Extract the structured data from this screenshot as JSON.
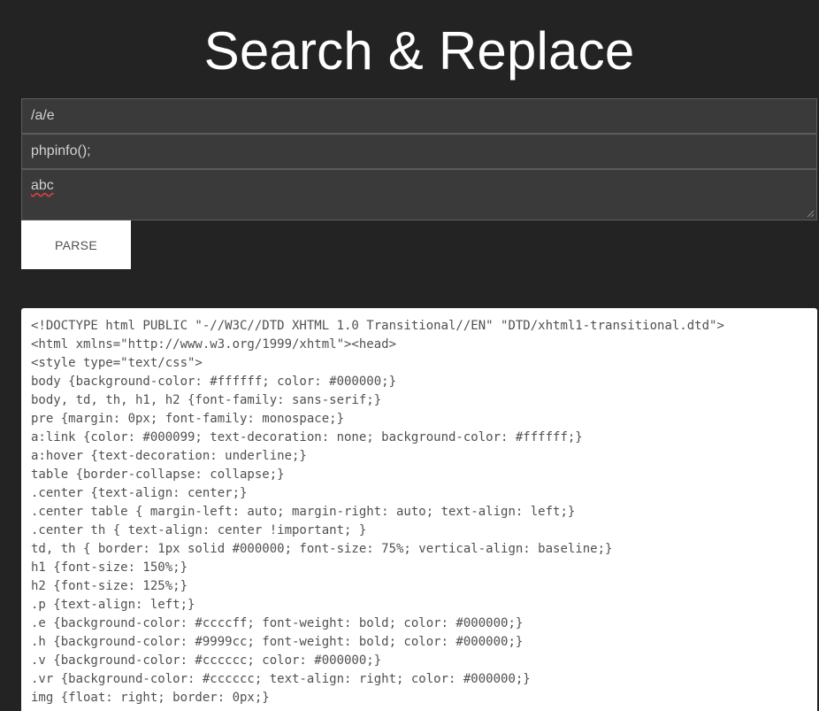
{
  "page": {
    "title": "Search & Replace"
  },
  "form": {
    "search_value": "/a/e",
    "replace_value": "phpinfo();",
    "subject_value": "abc",
    "parse_label": "PARSE"
  },
  "output": {
    "lines": [
      "<!DOCTYPE html PUBLIC \"-//W3C//DTD XHTML 1.0 Transitional//EN\" \"DTD/xhtml1-transitional.dtd\">",
      "<html xmlns=\"http://www.w3.org/1999/xhtml\"><head>",
      "<style type=\"text/css\">",
      "body {background-color: #ffffff; color: #000000;}",
      "body, td, th, h1, h2 {font-family: sans-serif;}",
      "pre {margin: 0px; font-family: monospace;}",
      "a:link {color: #000099; text-decoration: none; background-color: #ffffff;}",
      "a:hover {text-decoration: underline;}",
      "table {border-collapse: collapse;}",
      ".center {text-align: center;}",
      ".center table { margin-left: auto; margin-right: auto; text-align: left;}",
      ".center th { text-align: center !important; }",
      "td, th { border: 1px solid #000000; font-size: 75%; vertical-align: baseline;}",
      "h1 {font-size: 150%;}",
      "h2 {font-size: 125%;}",
      ".p {text-align: left;}",
      ".e {background-color: #ccccff; font-weight: bold; color: #000000;}",
      ".h {background-color: #9999cc; font-weight: bold; color: #000000;}",
      ".v {background-color: #cccccc; color: #000000;}",
      ".vr {background-color: #cccccc; text-align: right; color: #000000;}",
      "img {float: right; border: 0px;}"
    ]
  },
  "colors": {
    "background": "#232323",
    "field_background": "#3a3a3a",
    "button_background": "#ffffff",
    "output_background": "#ffffff",
    "output_text": "#505050"
  }
}
